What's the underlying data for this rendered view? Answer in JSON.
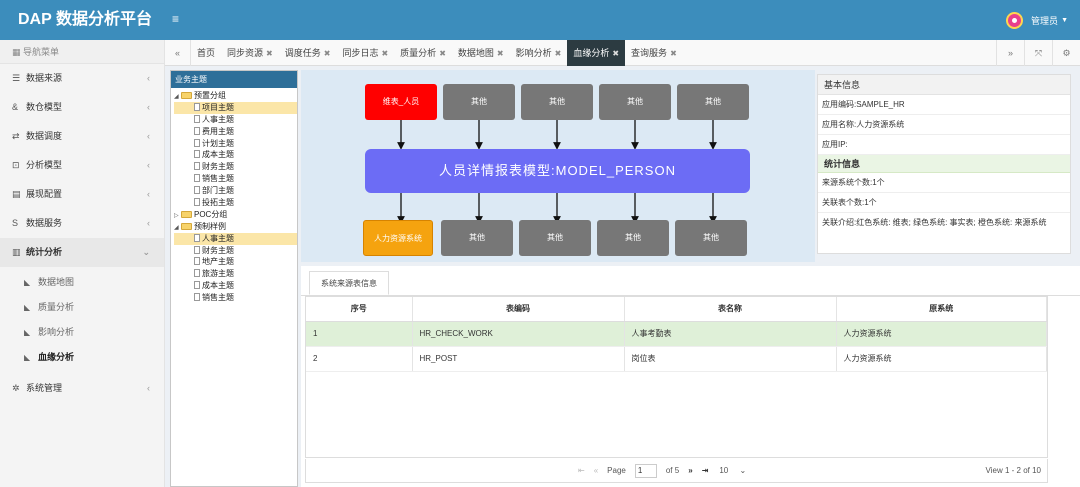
{
  "header": {
    "brand": "DAP 数据分析平台",
    "menu_toggle_icon": "≡",
    "user_name": "管理员"
  },
  "sidebar": {
    "title": "导航菜单",
    "items": [
      {
        "label": "数据来源",
        "icon": "database-icon"
      },
      {
        "label": "数仓模型",
        "icon": "model-icon"
      },
      {
        "label": "数据调度",
        "icon": "shuffle-icon"
      },
      {
        "label": "分析模型",
        "icon": "analysis-icon"
      },
      {
        "label": "展现配置",
        "icon": "display-icon"
      },
      {
        "label": "数据服务",
        "icon": "dollar-icon"
      },
      {
        "label": "统计分析",
        "icon": "bar-chart-icon"
      }
    ],
    "sub_items": [
      {
        "label": "数据地图"
      },
      {
        "label": "质量分析"
      },
      {
        "label": "影响分析"
      },
      {
        "label": "血缘分析"
      }
    ],
    "system": {
      "label": "系统管理"
    }
  },
  "tabs": [
    {
      "label": "首页",
      "closable": false
    },
    {
      "label": "同步资源",
      "closable": true
    },
    {
      "label": "调度任务",
      "closable": true
    },
    {
      "label": "同步日志",
      "closable": true
    },
    {
      "label": "质量分析",
      "closable": true
    },
    {
      "label": "数据地图",
      "closable": true
    },
    {
      "label": "影响分析",
      "closable": true
    },
    {
      "label": "血缘分析",
      "closable": true,
      "active": true
    },
    {
      "label": "查询服务",
      "closable": true
    }
  ],
  "tree": {
    "title": "业务主题",
    "nodes": [
      {
        "label": "预置分组",
        "level": 1,
        "type": "folder",
        "expanded": true
      },
      {
        "label": "项目主题",
        "level": 2,
        "type": "doc",
        "selected": true
      },
      {
        "label": "人事主题",
        "level": 2,
        "type": "doc"
      },
      {
        "label": "费用主题",
        "level": 2,
        "type": "doc"
      },
      {
        "label": "计划主题",
        "level": 2,
        "type": "doc"
      },
      {
        "label": "成本主题",
        "level": 2,
        "type": "doc"
      },
      {
        "label": "财务主题",
        "level": 2,
        "type": "doc"
      },
      {
        "label": "销售主题",
        "level": 2,
        "type": "doc"
      },
      {
        "label": "部门主题",
        "level": 2,
        "type": "doc"
      },
      {
        "label": "投拓主题",
        "level": 2,
        "type": "doc"
      },
      {
        "label": "POC分组",
        "level": 1,
        "type": "folder",
        "expanded": false
      },
      {
        "label": "预制样例",
        "level": 1,
        "type": "folder",
        "expanded": true
      },
      {
        "label": "人事主题",
        "level": 2,
        "type": "doc",
        "selected": true
      },
      {
        "label": "财务主题",
        "level": 2,
        "type": "doc"
      },
      {
        "label": "地产主题",
        "level": 2,
        "type": "doc"
      },
      {
        "label": "旅游主题",
        "level": 2,
        "type": "doc"
      },
      {
        "label": "成本主题",
        "level": 2,
        "type": "doc"
      },
      {
        "label": "销售主题",
        "level": 2,
        "type": "doc"
      }
    ]
  },
  "lineage": {
    "top_nodes": [
      {
        "label": "维表_人员",
        "color": "#ff0000"
      },
      {
        "label": "其他",
        "color": "#777777"
      },
      {
        "label": "其他",
        "color": "#777777"
      },
      {
        "label": "其他",
        "color": "#777777"
      },
      {
        "label": "其他",
        "color": "#777777"
      }
    ],
    "model_node": "人员详情报表模型:MODEL_PERSON",
    "model_color": "#6c6cf5",
    "bottom_nodes": [
      {
        "label": "人力资源系统",
        "color": "#f5a30f"
      },
      {
        "label": "其他",
        "color": "#777777"
      },
      {
        "label": "其他",
        "color": "#777777"
      },
      {
        "label": "其他",
        "color": "#777777"
      },
      {
        "label": "其他",
        "color": "#777777"
      }
    ]
  },
  "info": {
    "basic_title": "基本信息",
    "app_code": "应用编码:SAMPLE_HR",
    "app_name": "应用名称:人力资源系统",
    "app_ip": "应用IP:",
    "stats_title": "统计信息",
    "source_count": "来源系统个数:1个",
    "related_count": "关联表个数:1个",
    "legend_text": "关联介绍:红色系统: 维表; 绿色系统: 事实表; 橙色系统: 来源系统"
  },
  "source_table": {
    "tab_label": "系统来源表信息",
    "columns": [
      "序号",
      "表编码",
      "表名称",
      "原系统"
    ],
    "rows": [
      [
        "1",
        "HR_CHECK_WORK",
        "人事考勤表",
        "人力资源系统"
      ],
      [
        "2",
        "HR_POST",
        "岗位表",
        "人力资源系统"
      ]
    ],
    "highlight_color": "#dff0d8"
  },
  "pager": {
    "page_label": "Page",
    "page_value": "1",
    "of_label": "of 5",
    "page_size": "10",
    "view_text": "View 1 - 2 of 10"
  }
}
